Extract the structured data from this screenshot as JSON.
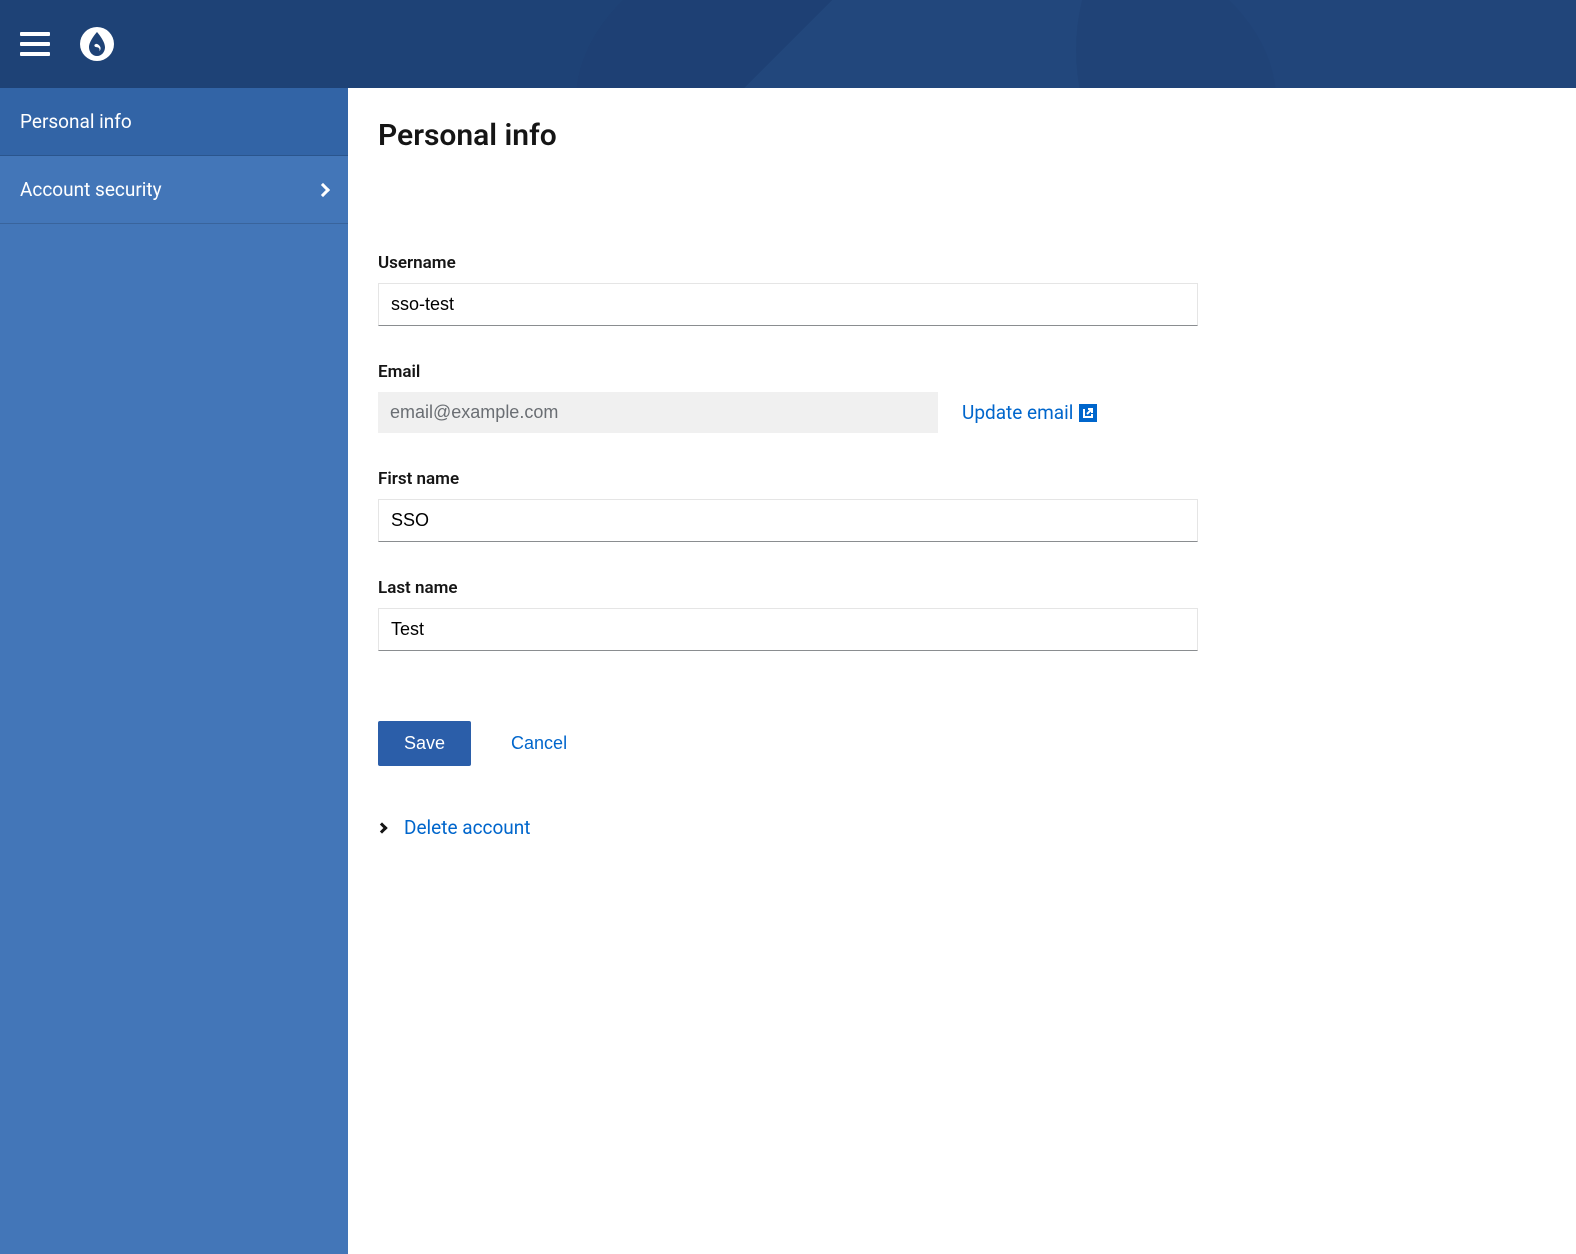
{
  "sidebar": {
    "items": [
      {
        "label": "Personal info",
        "active": true,
        "hasChildren": false
      },
      {
        "label": "Account security",
        "active": false,
        "hasChildren": true
      }
    ]
  },
  "page": {
    "title": "Personal info"
  },
  "form": {
    "username": {
      "label": "Username",
      "value": "sso-test"
    },
    "email": {
      "label": "Email",
      "value": "email@example.com",
      "updateLink": "Update email"
    },
    "firstName": {
      "label": "First name",
      "value": "SSO"
    },
    "lastName": {
      "label": "Last name",
      "value": "Test"
    }
  },
  "actions": {
    "save": "Save",
    "cancel": "Cancel",
    "deleteAccount": "Delete account"
  }
}
